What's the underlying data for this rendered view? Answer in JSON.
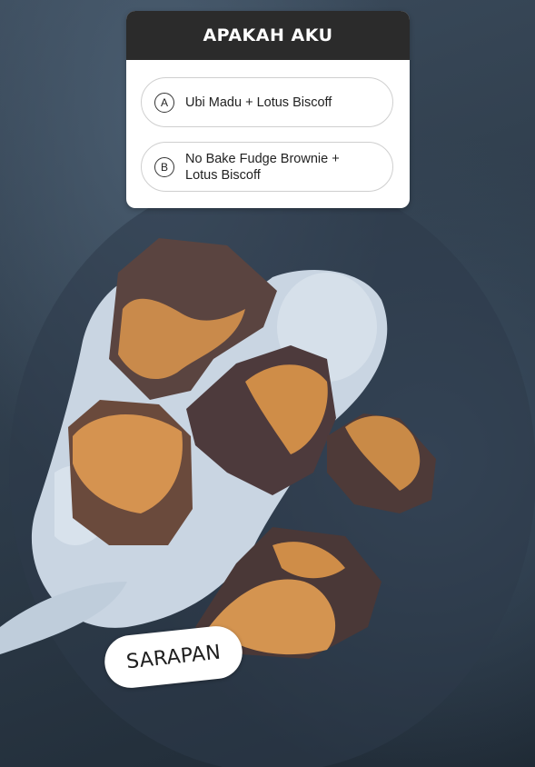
{
  "poll": {
    "title": "APAKAH AKU",
    "options": [
      {
        "letter": "A",
        "label": "Ubi Madu + Lotus Biscoff"
      },
      {
        "letter": "B",
        "label_line1": "No Bake Fudge Brownie +",
        "label_line2": "Lotus Biscoff"
      }
    ]
  },
  "sticker": {
    "text": "SARAPAN"
  },
  "photo": {
    "subject": "dessert-on-plate"
  }
}
